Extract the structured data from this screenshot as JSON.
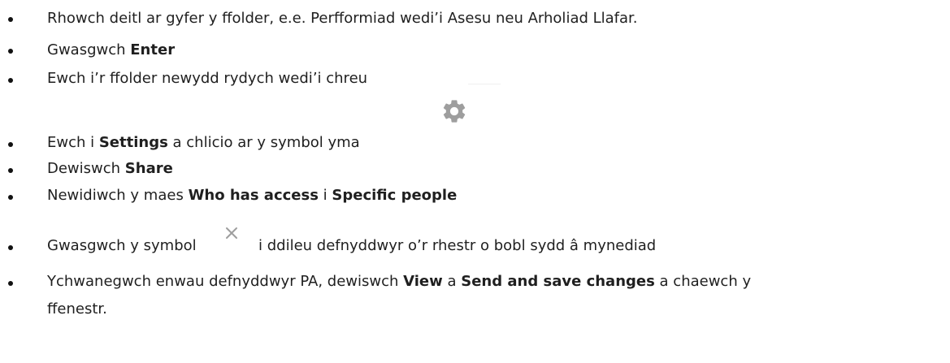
{
  "steps": [
    {
      "text": "Rhowch deitl ar gyfer y ffolder, e.e. Perfformiad wedi’i Asesu neu Arholiad Llafar."
    },
    {
      "pre": "Gwasgwch ",
      "bold": "Enter"
    },
    {
      "text": "Ewch i’r ffolder newydd rydych wedi’i chreu"
    },
    {
      "pre": "Ewch i ",
      "bold": "Settings",
      "post": " a chlicio ar y symbol yma"
    },
    {
      "pre": "Dewiswch ",
      "bold": "Share"
    },
    {
      "pre": "Newidiwch y maes ",
      "bold1": "Who has access",
      "mid": " i ",
      "bold2": "Specific people"
    },
    {
      "pre": "Gwasgwch y symbol",
      "post": "i ddileu defnyddwyr o’r rhestr o bobl sydd â mynediad"
    },
    {
      "pre": "Ychwanegwch enwau defnyddwyr PA, dewiswch ",
      "bold1": "View",
      "mid": " a ",
      "bold2": "Send and save changes",
      "post": " a chaewch y",
      "line2": "ffenestr."
    }
  ],
  "icons": {
    "settings": "gear-icon",
    "remove": "close-icon"
  },
  "colors": {
    "text": "#1f1f1f",
    "icon_gray": "#9e9e9e"
  }
}
